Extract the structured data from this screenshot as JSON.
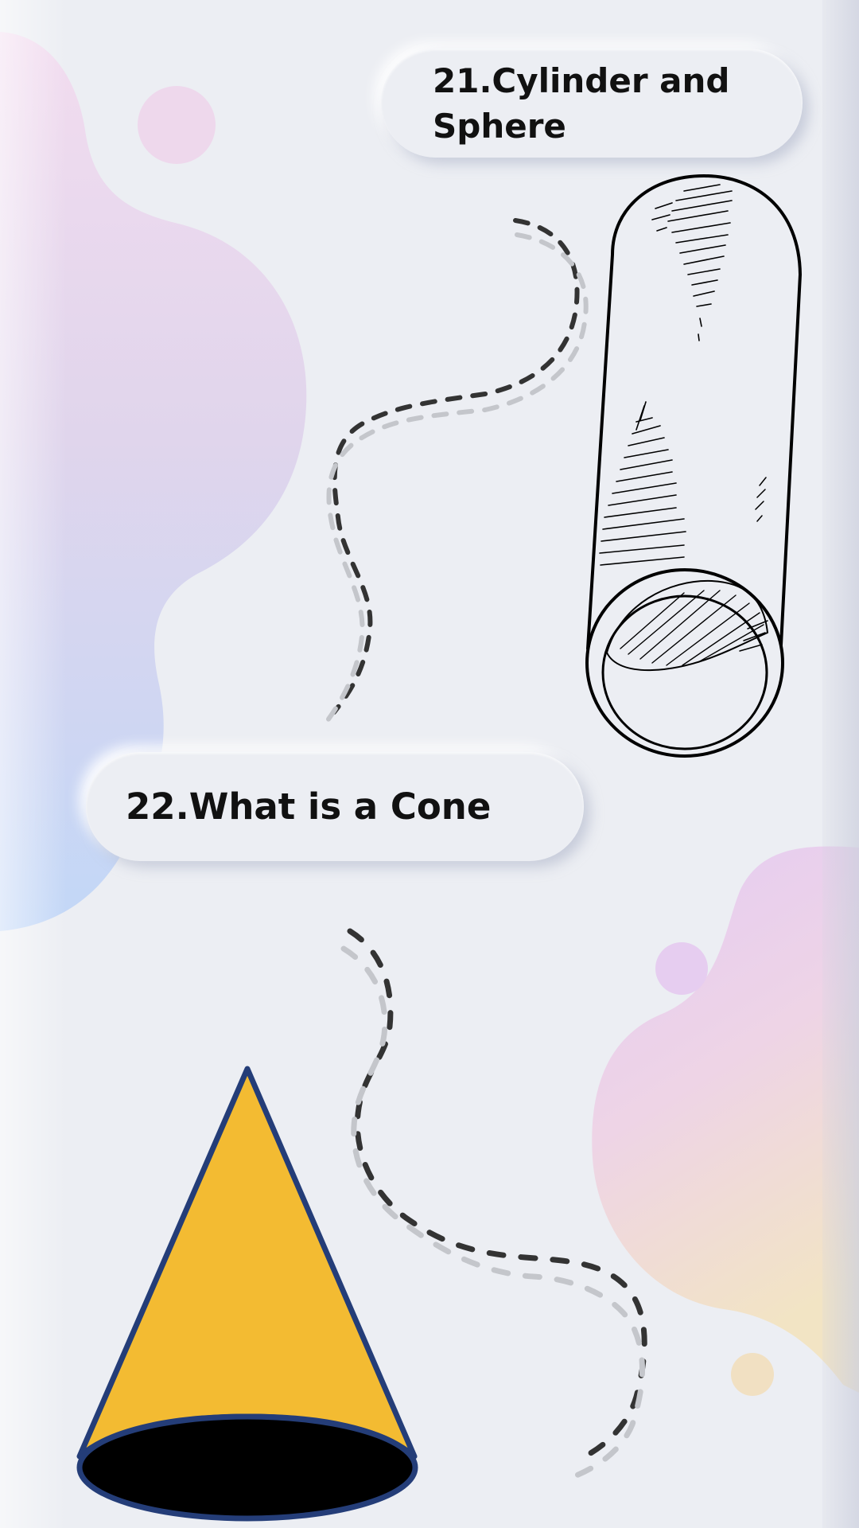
{
  "sections": [
    {
      "heading": "21.Cylinder and Sphere"
    },
    {
      "heading": "22.What is a Cone"
    }
  ],
  "colors": {
    "background": "#eceef3",
    "cone_fill": "#f3bb32",
    "cone_outline": "#243d78",
    "cone_base": "#000000",
    "blob_pink": "#ecd6ee",
    "blob_blue": "#c4d6f5",
    "blob_purple": "#e3c9f2",
    "blob_peach": "#f1e1c4",
    "dash_dark": "#333333",
    "dash_light": "#c4c6cb"
  },
  "illustrations": [
    {
      "icon": "cylinder-sketch-icon"
    },
    {
      "icon": "cone-icon"
    }
  ]
}
